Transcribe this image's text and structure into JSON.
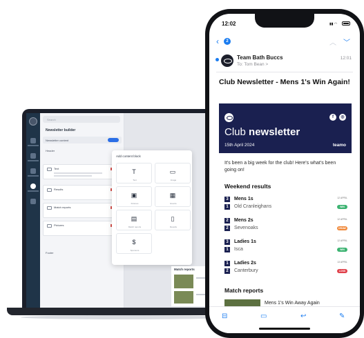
{
  "laptop": {
    "search_placeholder": "Search",
    "panel_title": "Newsletter builder",
    "newsletter_row": "Newsletter content",
    "header_label": "Header",
    "blocks": [
      "Text",
      "Results",
      "Match reports",
      "Pictures"
    ],
    "footer_label": "Footer",
    "add_block_title": "Add content block",
    "tiles": [
      {
        "icon": "text-icon",
        "label": "Text"
      },
      {
        "icon": "image-icon",
        "label": "Image"
      },
      {
        "icon": "fixtures-icon",
        "label": "Fixtures"
      },
      {
        "icon": "calendar-icon",
        "label": "Events"
      },
      {
        "icon": "match-report-icon",
        "label": "Match reports"
      },
      {
        "icon": "document-icon",
        "label": "Results"
      },
      {
        "icon": "sponsor-icon",
        "label": "Sponsors"
      }
    ],
    "mini_card_title": "Match reports"
  },
  "phone": {
    "status_time": "12:02",
    "nav_badge": "2",
    "sender": "Team Bath Buccs",
    "to": "To: Tom Bean >",
    "mail_time": "12:01",
    "subject": "Club Newsletter - Mens 1's Win Again!",
    "banner": {
      "title_light": "Club ",
      "title_bold": "newsletter",
      "date": "15th April 2024",
      "brand": "teamo"
    },
    "intro": "It's been a big week for the club! Here's what's been going on!",
    "weekend_results_title": "Weekend results",
    "results": [
      {
        "home_score": "3",
        "home": "Mens 1s",
        "away_score": "1",
        "away": "Old Cranleighans",
        "time": "12 APRIL",
        "outcome": "WIN",
        "color": "#3cb371"
      },
      {
        "home_score": "2",
        "home": "Mens 2s",
        "away_score": "2",
        "away": "Sevenoaks",
        "time": "12 APRIL",
        "outcome": "DRAW",
        "color": "#f08a3c"
      },
      {
        "home_score": "3",
        "home": "Ladies 1s",
        "away_score": "1",
        "away": "Isca",
        "time": "12 APRIL",
        "outcome": "WIN",
        "color": "#3cb371"
      },
      {
        "home_score": "1",
        "home": "Ladies 2s",
        "away_score": "2",
        "away": "Canterbury",
        "time": "13 APRIL",
        "outcome": "LOSS",
        "color": "#e0404a"
      }
    ],
    "match_reports_title": "Match reports",
    "report_title": "Mens 1's Win Away Again"
  }
}
